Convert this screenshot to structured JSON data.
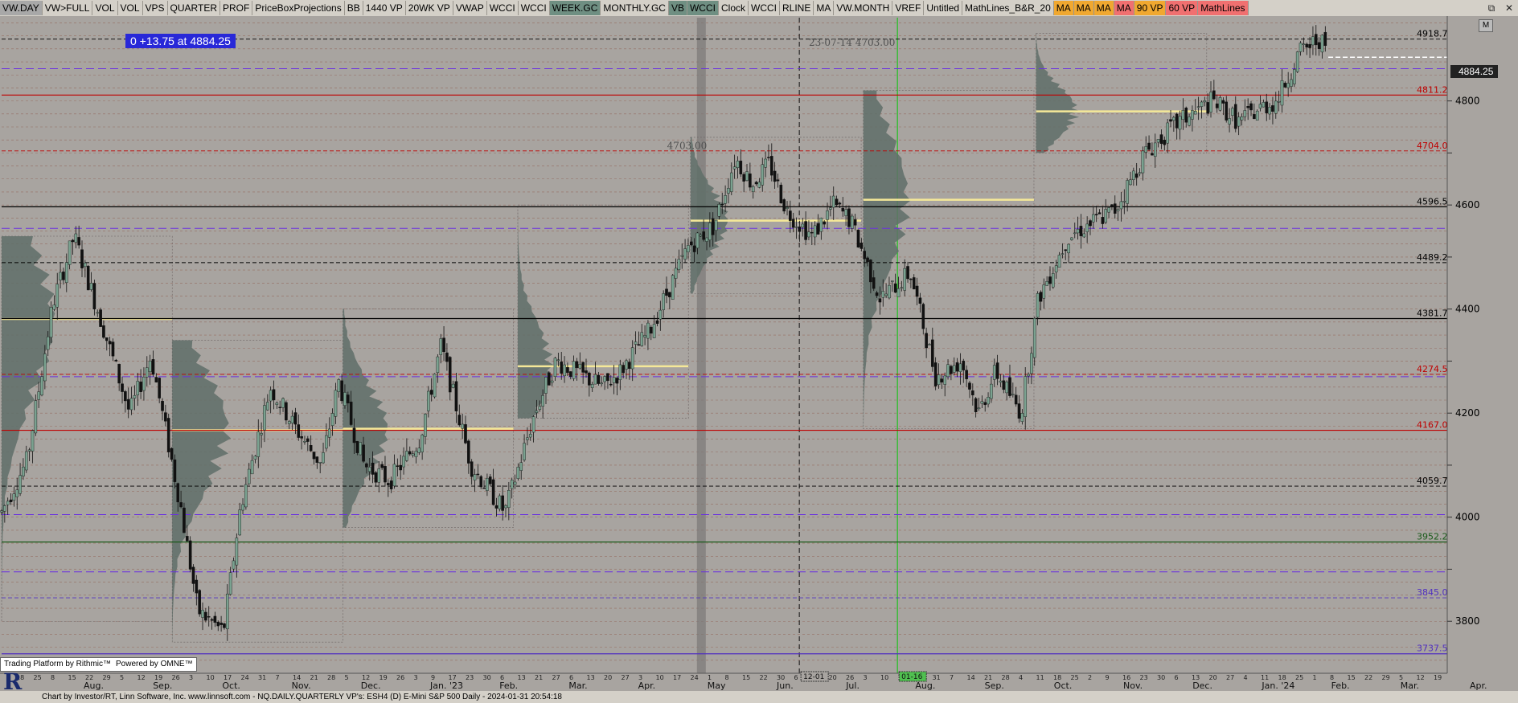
{
  "toolbar": {
    "buttons": [
      {
        "label": "VW.DAY",
        "color": "#a8a8a8"
      },
      {
        "label": "VW>FULL",
        "color": "#d4d0c8"
      },
      {
        "label": "VOL",
        "color": "#d4d0c8"
      },
      {
        "label": "VOL",
        "color": "#d4d0c8"
      },
      {
        "label": "VPS",
        "color": "#d4d0c8"
      },
      {
        "label": "QUARTER",
        "color": "#d4d0c8"
      },
      {
        "label": "PROF",
        "color": "#d4d0c8"
      },
      {
        "label": "PriceBoxProjections",
        "color": "#d4d0c8"
      },
      {
        "label": "BB",
        "color": "#d4d0c8"
      },
      {
        "label": "1440 VP",
        "color": "#d4d0c8"
      },
      {
        "label": "20WK VP",
        "color": "#d4d0c8"
      },
      {
        "label": "VWAP",
        "color": "#d4d0c8"
      },
      {
        "label": "WCCI",
        "color": "#d4d0c8"
      },
      {
        "label": "WCCI",
        "color": "#d4d0c8"
      },
      {
        "label": "WEEK.GC",
        "color": "#6f8f82"
      },
      {
        "label": "MONTHLY.GC",
        "color": "#d4d0c8"
      },
      {
        "label": "VB",
        "color": "#6f8f82"
      },
      {
        "label": "WCCI",
        "color": "#6f8f82"
      },
      {
        "label": "Clock",
        "color": "#d4d0c8"
      },
      {
        "label": "WCCI",
        "color": "#d4d0c8"
      },
      {
        "label": "RLINE",
        "color": "#d4d0c8"
      },
      {
        "label": "MA",
        "color": "#d4d0c8"
      },
      {
        "label": "VW.MONTH",
        "color": "#d4d0c8"
      },
      {
        "label": "VREF",
        "color": "#d4d0c8"
      },
      {
        "label": "Untitled",
        "color": "#d4d0c8"
      },
      {
        "label": "MathLines_B&R_20",
        "color": "#d4d0c8"
      },
      {
        "label": "MA",
        "color": "#f0a830"
      },
      {
        "label": "MA",
        "color": "#f0a830"
      },
      {
        "label": "MA",
        "color": "#f0a830"
      },
      {
        "label": "MA",
        "color": "#f07070"
      },
      {
        "label": "90 VP",
        "color": "#f0a830"
      },
      {
        "label": "60 VP",
        "color": "#f07070"
      },
      {
        "label": "MathLines",
        "color": "#f07070"
      }
    ]
  },
  "window_controls": [
    "⧉",
    "✕"
  ],
  "change_box": "0  +13.75 at 4884.25",
  "annotation_top": "23-07-14  4703.00",
  "annotation_mid": "4703.00",
  "last_price": "4884.25",
  "m_label": "M",
  "platform_bar": {
    "rithmic": "Trading Platform by Rithmic™",
    "omne": "Powered by OMNE™"
  },
  "logo": "R",
  "status": "Chart by Investor/RT, Linn Software, Inc. www.linnsoft.com - NQ.DAILY.QUARTERLY VP's: ESH4 (D) E-Mini S&P 500 Daily - 2024-01-31 20:54:18",
  "colors": {
    "background": "#a8a4a0",
    "up": "#7aa290",
    "down": "#111111",
    "volume_profile": "#5f6e68",
    "poc": "#f5e898"
  },
  "chart_data": {
    "type": "candlestick",
    "title": "NQ.DAILY.QUARTERLY VP's: ESH4 (D) E-Mini S&P 500 Daily",
    "ylim": [
      3700,
      4960
    ],
    "y_ticks": [
      3800,
      3900,
      4000,
      4100,
      4200,
      4300,
      4400,
      4500,
      4600,
      4700,
      4800
    ],
    "y_tick_labels": [
      "3800",
      "4000",
      "4200",
      "4400",
      "4600",
      "4800"
    ],
    "x_months": [
      "Aug.",
      "Sep.",
      "Oct.",
      "Nov.",
      "Dec.",
      "Jan. '23",
      "Feb.",
      "Mar.",
      "Apr.",
      "May",
      "Jun.",
      "Jul.",
      "Aug.",
      "Sep.",
      "Oct.",
      "Nov.",
      "Dec.",
      "Jan. '24",
      "Feb.",
      "Mar.",
      "Apr."
    ],
    "x_day_ticks": [
      "18",
      "25",
      "8",
      "15",
      "22",
      "29",
      "5",
      "12",
      "19",
      "26",
      "3",
      "10",
      "17",
      "24",
      "31",
      "7",
      "14",
      "21",
      "28",
      "5",
      "12",
      "19",
      "26",
      "3",
      "9",
      "17",
      "23",
      "30",
      "6",
      "13",
      "21",
      "27",
      "6",
      "13",
      "20",
      "27",
      "3",
      "10",
      "17",
      "24",
      "1",
      "8",
      "15",
      "22",
      "30",
      "6",
      "12",
      "20",
      "26",
      "3",
      "10",
      "17",
      "24",
      "31",
      "7",
      "14",
      "21",
      "28",
      "4",
      "11",
      "18",
      "25",
      "2",
      "9",
      "16",
      "23",
      "30",
      "6",
      "13",
      "20",
      "27",
      "4",
      "11",
      "18",
      "25",
      "1",
      "8",
      "15",
      "22",
      "29",
      "5",
      "12",
      "19",
      "26",
      "4",
      "11",
      "18",
      "25"
    ],
    "levels": [
      {
        "value": 4918.75,
        "label": "4918.75",
        "color": "#000000",
        "style": "dashed"
      },
      {
        "value": 4811.25,
        "label": "4811.25",
        "color": "#c00000",
        "style": "solid"
      },
      {
        "value": 4704.0,
        "label": "4704.00",
        "color": "#c00000",
        "style": "dashed"
      },
      {
        "value": 4596.5,
        "label": "4596.50",
        "color": "#000000",
        "style": "solid"
      },
      {
        "value": 4489.25,
        "label": "4489.25",
        "color": "#000000",
        "style": "dashed"
      },
      {
        "value": 4381.75,
        "label": "4381.75",
        "color": "#000000",
        "style": "solid"
      },
      {
        "value": 4274.5,
        "label": "4274.50",
        "color": "#c00000",
        "style": "dashed"
      },
      {
        "value": 4167.0,
        "label": "4167.00",
        "color": "#c00000",
        "style": "solid"
      },
      {
        "value": 4059.75,
        "label": "4059.75",
        "color": "#000000",
        "style": "dashed"
      },
      {
        "value": 3952.25,
        "label": "3952.25",
        "color": "#1a5a1a",
        "style": "solid"
      },
      {
        "value": 3845.0,
        "label": "3845.00",
        "color": "#5030c0",
        "style": "dashed"
      },
      {
        "value": 3737.5,
        "label": "3737.50",
        "color": "#5030c0",
        "style": "solid"
      }
    ],
    "date_labels": [
      {
        "text": "12-01",
        "day": 374
      },
      {
        "text": "01-16",
        "day": 420
      }
    ],
    "series": [
      {
        "name": "NQ.DAILY",
        "anchors": [
          [
            0,
            4010
          ],
          [
            12,
            4110
          ],
          [
            24,
            4410
          ],
          [
            34,
            4540
          ],
          [
            48,
            4360
          ],
          [
            60,
            4200
          ],
          [
            70,
            4310
          ],
          [
            84,
            4020
          ],
          [
            92,
            3820
          ],
          [
            104,
            3780
          ],
          [
            112,
            4020
          ],
          [
            126,
            4250
          ],
          [
            138,
            4170
          ],
          [
            150,
            4100
          ],
          [
            158,
            4260
          ],
          [
            170,
            4100
          ],
          [
            182,
            4070
          ],
          [
            196,
            4150
          ],
          [
            206,
            4330
          ],
          [
            220,
            4100
          ],
          [
            236,
            4010
          ],
          [
            250,
            4200
          ],
          [
            260,
            4300
          ],
          [
            282,
            4250
          ],
          [
            290,
            4280
          ],
          [
            304,
            4360
          ],
          [
            322,
            4520
          ],
          [
            334,
            4560
          ],
          [
            344,
            4690
          ],
          [
            352,
            4640
          ],
          [
            360,
            4680
          ],
          [
            368,
            4590
          ],
          [
            380,
            4540
          ],
          [
            390,
            4600
          ],
          [
            398,
            4570
          ],
          [
            412,
            4420
          ],
          [
            426,
            4470
          ],
          [
            438,
            4270
          ],
          [
            450,
            4300
          ],
          [
            458,
            4200
          ],
          [
            466,
            4280
          ],
          [
            478,
            4200
          ],
          [
            486,
            4420
          ],
          [
            500,
            4540
          ],
          [
            522,
            4590
          ],
          [
            536,
            4700
          ],
          [
            552,
            4760
          ],
          [
            568,
            4800
          ],
          [
            580,
            4760
          ],
          [
            592,
            4790
          ],
          [
            598,
            4800
          ],
          [
            608,
            4890
          ],
          [
            618,
            4920
          ],
          [
            622,
            4884
          ]
        ]
      }
    ]
  }
}
